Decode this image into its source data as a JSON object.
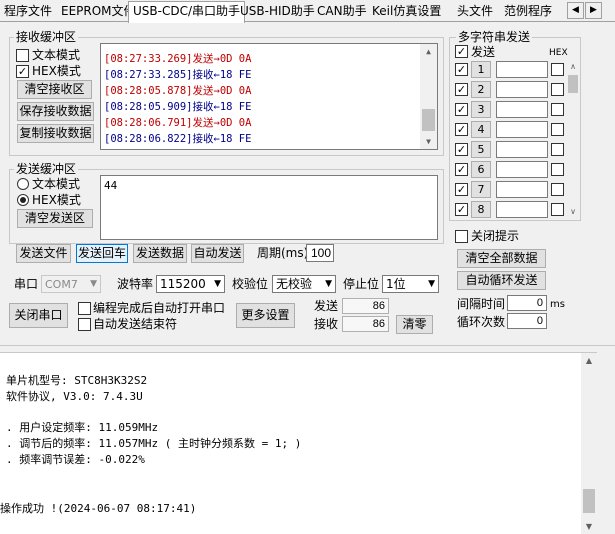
{
  "tabs": [
    {
      "label": "程序文件"
    },
    {
      "label": "EEPROM文件"
    },
    {
      "label": "USB-CDC/串口助手",
      "active": true
    },
    {
      "label": "USB-HID助手"
    },
    {
      "label": "CAN助手"
    },
    {
      "label": "Keil仿真设置"
    },
    {
      "label": "头文件"
    },
    {
      "label": "范例程序"
    }
  ],
  "tab_nav": {
    "prev": "◀",
    "next": "▶"
  },
  "receive": {
    "title": "接收缓冲区",
    "text_mode": "文本模式",
    "hex_mode": "HEX模式",
    "text_mode_checked": false,
    "hex_mode_checked": true,
    "clear_btn": "清空接收区",
    "save_btn": "保存接收数据",
    "copy_btn": "复制接收数据",
    "lines": [
      {
        "time": "[08:27:33.269]",
        "dir": "发送→",
        "data": "0D 0A",
        "color": "#c00000"
      },
      {
        "time": "[08:27:33.285]",
        "dir": "接收←",
        "data": "18 FE",
        "color": "#00008b"
      },
      {
        "time": "[08:28:05.878]",
        "dir": "发送→",
        "data": "0D 0A",
        "color": "#c00000"
      },
      {
        "time": "[08:28:05.909]",
        "dir": "接收←",
        "data": "18 FE",
        "color": "#00008b"
      },
      {
        "time": "[08:28:06.791]",
        "dir": "发送→",
        "data": "0D 0A",
        "color": "#c00000"
      },
      {
        "time": "[08:28:06.822]",
        "dir": "接收←",
        "data": "18 FE",
        "color": "#00008b"
      }
    ]
  },
  "send": {
    "title": "发送缓冲区",
    "text_mode": "文本模式",
    "hex_mode": "HEX模式",
    "text_mode_selected": false,
    "hex_mode_selected": true,
    "clear_btn": "清空发送区",
    "content": "44"
  },
  "send_actions": {
    "send_file": "发送文件",
    "send_enter": "发送回车",
    "send_data": "发送数据",
    "auto_send": "自动发送",
    "period_label": "周期(ms)",
    "period_value": "100"
  },
  "serial": {
    "port_label": "串口",
    "port_value": "COM7",
    "baud_label": "波特率",
    "baud_value": "115200",
    "parity_label": "校验位",
    "parity_value": "无校验",
    "stop_label": "停止位",
    "stop_value": "1位",
    "close_btn": "关闭串口",
    "auto_open": "编程完成后自动打开串口",
    "auto_end": "自动发送结束符",
    "more_btn": "更多设置",
    "sent_label": "发送",
    "sent_value": "86",
    "recv_label": "接收",
    "recv_value": "86",
    "clear_btn": "清零"
  },
  "multi": {
    "title": "多字符串发送",
    "send_header": "发送",
    "hex_header": "HEX",
    "rows": [
      "1",
      "2",
      "3",
      "4",
      "5",
      "6",
      "7",
      "8"
    ],
    "close_hint": "关闭提示",
    "clear_all": "清空全部数据",
    "auto_loop": "自动循环发送",
    "interval_label": "间隔时间",
    "interval_value": "0",
    "interval_unit": "ms",
    "loop_label": "循环次数",
    "loop_value": "0"
  },
  "log": {
    "lines": [
      "单片机型号: STC8H3K32S2",
      "软件协议, V3.0: 7.4.3U",
      "",
      ". 用户设定频率: 11.059MHz",
      ". 调节后的频率: 11.057MHz ( 主时钟分频系数 = 1; )",
      ". 频率调节误差: -0.022%",
      "",
      "",
      "操作成功 !(2024-06-07 08:17:41)"
    ]
  }
}
